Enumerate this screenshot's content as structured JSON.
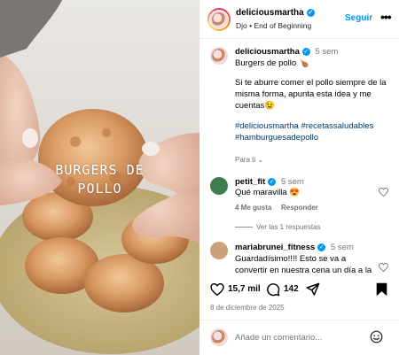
{
  "media": {
    "overlay_line1": "BURGERS DE",
    "overlay_line2": "POLLO"
  },
  "header": {
    "username": "deliciousmartha",
    "subtitle": "Djo • End of Beginning",
    "follow_label": "Seguir",
    "more_label": "•••"
  },
  "caption": {
    "username": "deliciousmartha",
    "time": "5 sem",
    "title": "Burgers de pollo 🍗",
    "body_lines": [
      "Si te aburre comer el pollo siempre de la",
      "misma forma, apunta esta idea y me",
      "cuentas😉"
    ],
    "hashtags_line1": "#deliciousmartha #recetassaludables",
    "hashtags_line2": "#hamburguesadepollo",
    "translate": "Para ti",
    "translate_chevron": "⌄"
  },
  "comments": [
    {
      "username": "petit_fit",
      "time": "5 sem",
      "text": "Qué maravilla 😍",
      "likes": "4 Me gusta",
      "reply": "Responder"
    },
    {
      "username": "mariabrunei_fitness",
      "time": "5 sem",
      "text_line1": "Guardadísimo!!!! Esto se va a",
      "text_line2": "convertir en nuestra cena un día a la"
    }
  ],
  "view_replies": "Ver las 1 respuestas",
  "actions": {
    "likes_count": "15,7 mil",
    "comments_count": "142"
  },
  "post_date": "8 de diciembre de 2025",
  "footer": {
    "placeholder": "Añade un comentario..."
  },
  "colors": {
    "accent": "#0095f6",
    "link": "#00376b",
    "muted": "#737373"
  }
}
